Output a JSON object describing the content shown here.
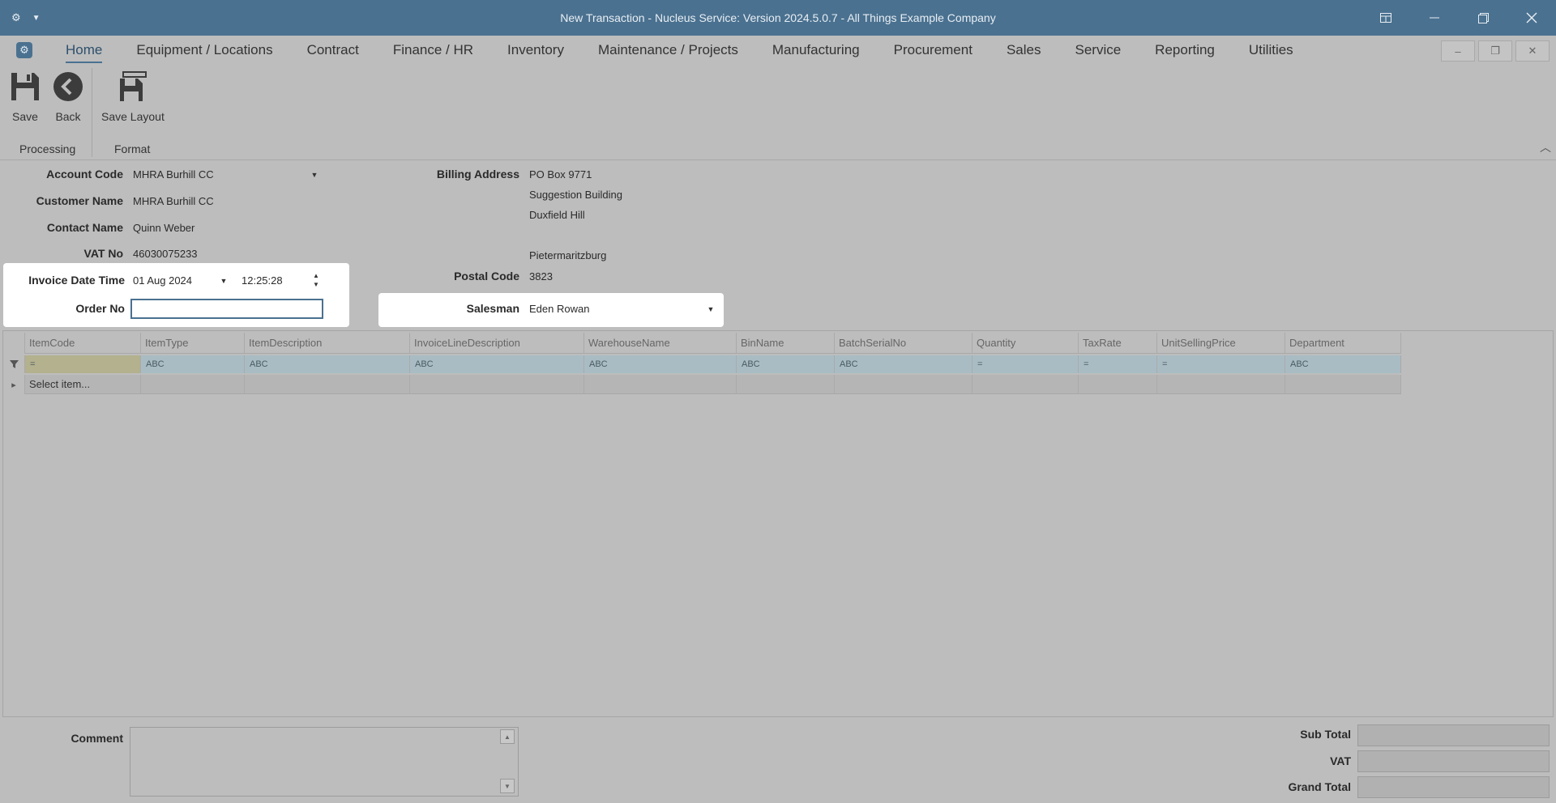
{
  "window": {
    "title": "New Transaction - Nucleus Service: Version 2024.5.0.7 - All Things Example Company",
    "left_icons": [
      "gear-icon",
      "dropdown-icon"
    ],
    "controls": [
      "layout-icon",
      "minimize-icon",
      "restore-icon",
      "close-icon"
    ]
  },
  "menu": {
    "tabs": [
      "Home",
      "Equipment / Locations",
      "Contract",
      "Finance / HR",
      "Inventory",
      "Maintenance / Projects",
      "Manufacturing",
      "Procurement",
      "Sales",
      "Service",
      "Reporting",
      "Utilities"
    ],
    "active_tab": "Home"
  },
  "ribbon": {
    "save_label": "Save",
    "back_label": "Back",
    "save_layout_label": "Save Layout",
    "group_processing": "Processing",
    "group_format": "Format"
  },
  "form": {
    "account_code_label": "Account Code",
    "account_code": "MHRA Burhill CC",
    "customer_name_label": "Customer Name",
    "customer_name": "MHRA Burhill CC",
    "contact_name_label": "Contact Name",
    "contact_name": "Quinn Weber",
    "vat_no_label": "VAT No",
    "vat_no": "46030075233",
    "invoice_datetime_label": "Invoice Date Time",
    "invoice_date": "01 Aug 2024",
    "invoice_time": "12:25:28",
    "order_no_label": "Order No",
    "order_no": "",
    "billing_address_label": "Billing Address",
    "billing_address_lines": [
      "PO Box 9771",
      "Suggestion Building",
      "Duxfield Hill",
      "",
      "Pietermaritzburg"
    ],
    "postal_code_label": "Postal Code",
    "postal_code": "3823",
    "salesman_label": "Salesman",
    "salesman": "Eden Rowan"
  },
  "grid": {
    "columns": [
      "ItemCode",
      "ItemType",
      "ItemDescription",
      "InvoiceLineDescription",
      "WarehouseName",
      "BinName",
      "BatchSerialNo",
      "Quantity",
      "TaxRate",
      "UnitSellingPrice",
      "Department"
    ],
    "filter_symbols": [
      "=",
      "ABC",
      "ABC",
      "ABC",
      "ABC",
      "ABC",
      "ABC",
      "=",
      "=",
      "=",
      "ABC"
    ],
    "new_row_placeholder": "Select item..."
  },
  "footer": {
    "comment_label": "Comment",
    "comment": "",
    "sub_total_label": "Sub Total",
    "vat_label": "VAT",
    "grand_total_label": "Grand Total",
    "sub_total": "",
    "vat": "",
    "grand_total": ""
  }
}
